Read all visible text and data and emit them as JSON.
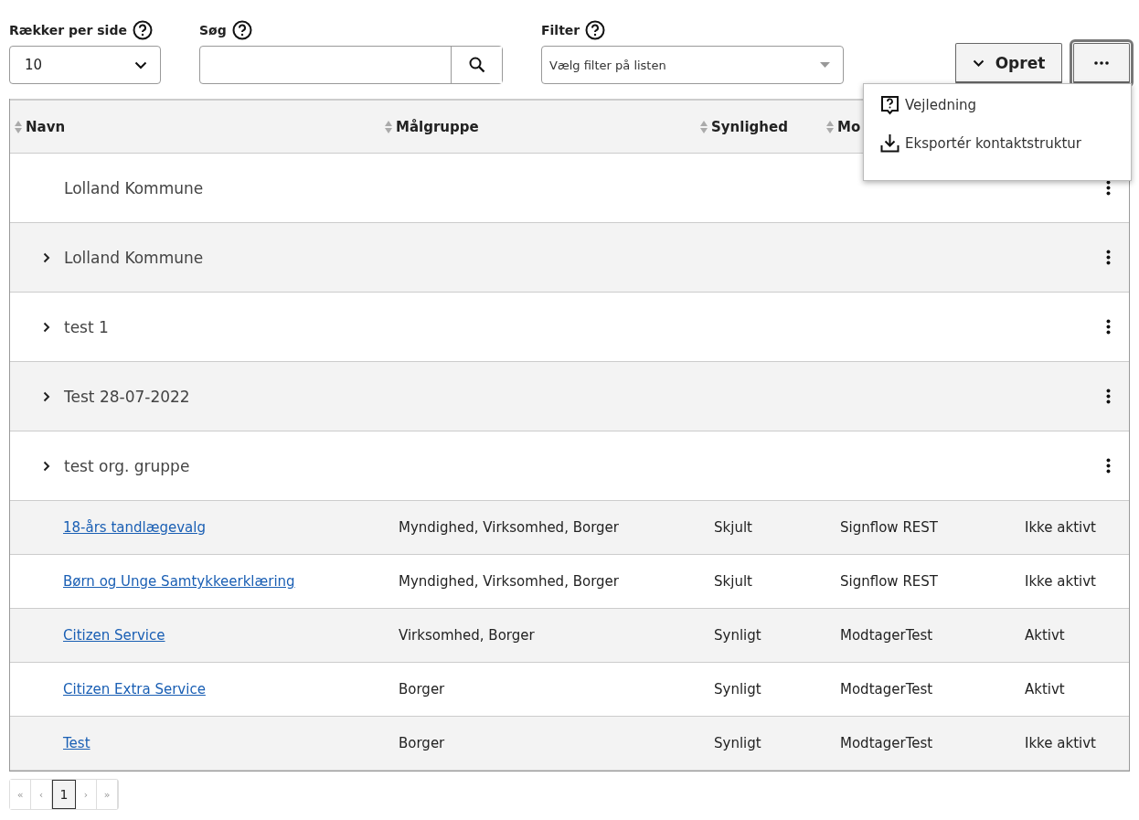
{
  "toolbar": {
    "rows_per_page": {
      "label": "Rækker per side",
      "value": "10"
    },
    "search": {
      "label": "Søg"
    },
    "filter": {
      "label": "Filter",
      "placeholder": "Vælg filter på listen"
    },
    "create_button": "Opret",
    "more_button": {
      "expanded": true
    }
  },
  "menu": [
    "Vejledning",
    "Eksportér kontaktstruktur"
  ],
  "table": {
    "columns": [
      "Navn",
      "Målgruppe",
      "Synlighed",
      "Mo"
    ],
    "groups": [
      {
        "name": "Lolland Kommune",
        "expandable": false
      },
      {
        "name": "Lolland Kommune",
        "expandable": true
      },
      {
        "name": "test 1",
        "expandable": true
      },
      {
        "name": "Test 28-07-2022",
        "expandable": true
      },
      {
        "name": "test org. gruppe",
        "expandable": true
      }
    ],
    "rows": [
      {
        "name": "18-års tandlægevalg",
        "audience": "Myndighed, Virksomhed, Borger",
        "visibility": "Skjult",
        "recipient": "Signflow REST",
        "status": "Ikke aktivt"
      },
      {
        "name": "Børn og Unge Samtykkeerklæring",
        "audience": "Myndighed, Virksomhed, Borger",
        "visibility": "Skjult",
        "recipient": "Signflow REST",
        "status": "Ikke aktivt"
      },
      {
        "name": "Citizen Service",
        "audience": "Virksomhed, Borger",
        "visibility": "Synligt",
        "recipient": "ModtagerTest",
        "status": "Aktivt"
      },
      {
        "name": "Citizen Extra Service",
        "audience": "Borger",
        "visibility": "Synligt",
        "recipient": "ModtagerTest",
        "status": "Aktivt"
      },
      {
        "name": "Test",
        "audience": "Borger",
        "visibility": "Synligt",
        "recipient": "ModtagerTest",
        "status": "Ikke aktivt"
      }
    ]
  },
  "pagination": {
    "first": "«",
    "prev": "‹",
    "pages": [
      {
        "label": "1",
        "selected": true
      }
    ],
    "next": "›",
    "last": "»"
  }
}
